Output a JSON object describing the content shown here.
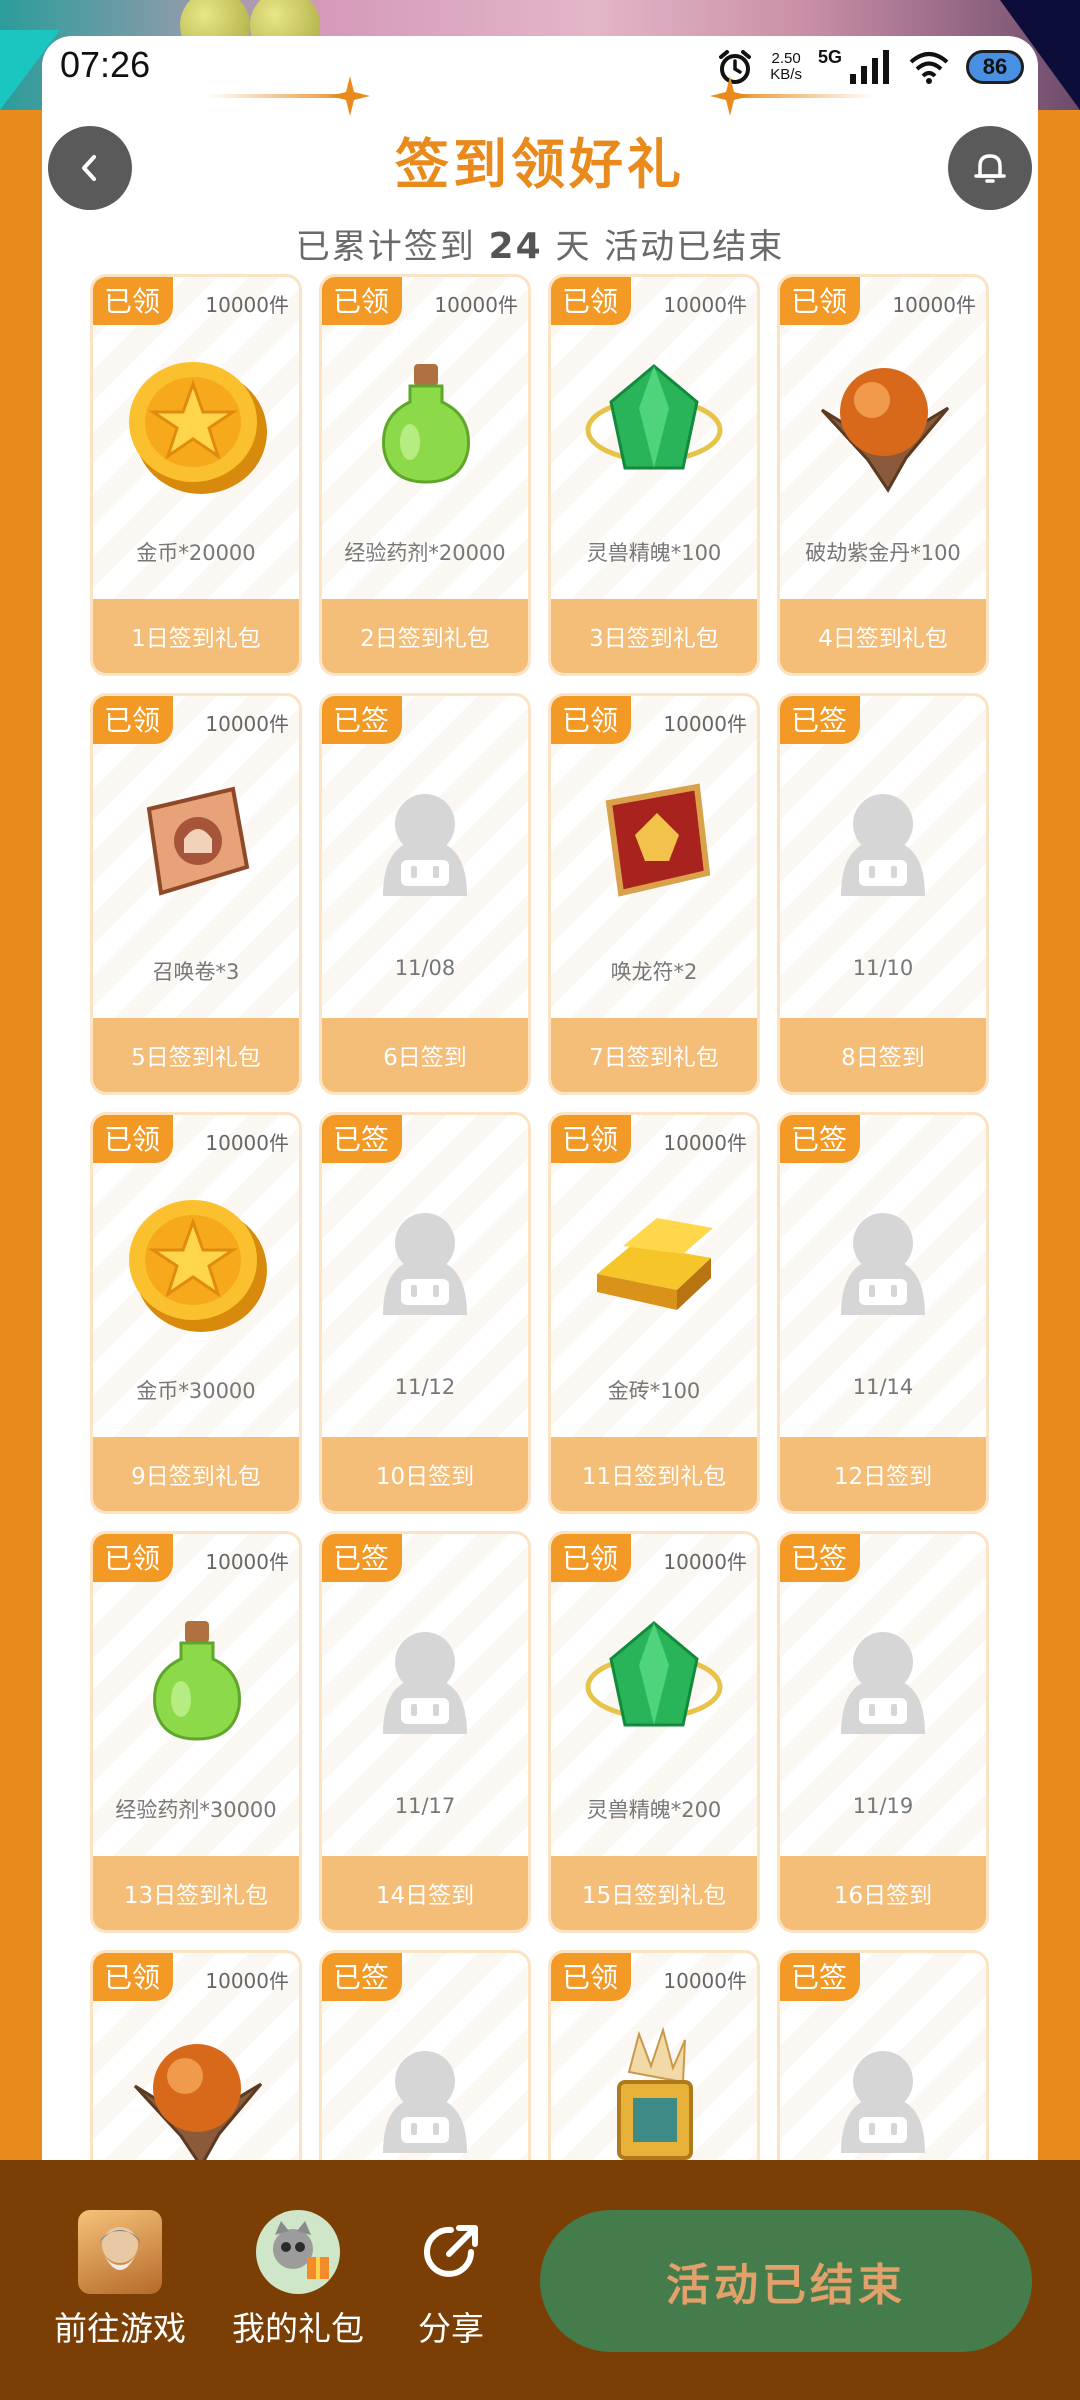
{
  "status_bar": {
    "time": "07:26",
    "net_speed_value": "2.50",
    "net_speed_unit": "KB/s",
    "network": "5G",
    "battery": "86"
  },
  "header": {
    "title": "签到领好礼",
    "subtitle_prefix": "已累计签到",
    "days": "24",
    "subtitle_suffix": "天  活动已结束"
  },
  "cards": [
    {
      "badge": "已领",
      "qty": "10000件",
      "icon": "gold-coin",
      "name": "金币*20000",
      "footer": "1日签到礼包"
    },
    {
      "badge": "已领",
      "qty": "10000件",
      "icon": "exp-potion",
      "name": "经验药剂*20000",
      "footer": "2日签到礼包"
    },
    {
      "badge": "已领",
      "qty": "10000件",
      "icon": "green-gem",
      "name": "灵兽精魄*100",
      "footer": "3日签到礼包"
    },
    {
      "badge": "已领",
      "qty": "10000件",
      "icon": "orange-orb",
      "name": "破劫紫金丹*100",
      "footer": "4日签到礼包"
    },
    {
      "badge": "已领",
      "qty": "10000件",
      "icon": "summon-scroll",
      "name": "召唤卷*3",
      "footer": "5日签到礼包"
    },
    {
      "badge": "已签",
      "qty": "",
      "icon": "placeholder",
      "name": "11/08",
      "footer": "6日签到"
    },
    {
      "badge": "已领",
      "qty": "10000件",
      "icon": "dragon-talisman",
      "name": "唤龙符*2",
      "footer": "7日签到礼包"
    },
    {
      "badge": "已签",
      "qty": "",
      "icon": "placeholder",
      "name": "11/10",
      "footer": "8日签到"
    },
    {
      "badge": "已领",
      "qty": "10000件",
      "icon": "gold-coin",
      "name": "金币*30000",
      "footer": "9日签到礼包"
    },
    {
      "badge": "已签",
      "qty": "",
      "icon": "placeholder",
      "name": "11/12",
      "footer": "10日签到"
    },
    {
      "badge": "已领",
      "qty": "10000件",
      "icon": "gold-bar",
      "name": "金砖*100",
      "footer": "11日签到礼包"
    },
    {
      "badge": "已签",
      "qty": "",
      "icon": "placeholder",
      "name": "11/14",
      "footer": "12日签到"
    },
    {
      "badge": "已领",
      "qty": "10000件",
      "icon": "exp-potion",
      "name": "经验药剂*30000",
      "footer": "13日签到礼包"
    },
    {
      "badge": "已签",
      "qty": "",
      "icon": "placeholder",
      "name": "11/17",
      "footer": "14日签到"
    },
    {
      "badge": "已领",
      "qty": "10000件",
      "icon": "green-gem",
      "name": "灵兽精魄*200",
      "footer": "15日签到礼包"
    },
    {
      "badge": "已签",
      "qty": "",
      "icon": "placeholder",
      "name": "11/19",
      "footer": "16日签到"
    },
    {
      "badge": "已领",
      "qty": "10000件",
      "icon": "orange-orb",
      "name": "",
      "footer": ""
    },
    {
      "badge": "已签",
      "qty": "",
      "icon": "placeholder",
      "name": "",
      "footer": ""
    },
    {
      "badge": "已领",
      "qty": "10000件",
      "icon": "crystal-lantern",
      "name": "",
      "footer": ""
    },
    {
      "badge": "已签",
      "qty": "",
      "icon": "placeholder",
      "name": "",
      "footer": ""
    }
  ],
  "bottom_nav": {
    "go_game": "前往游戏",
    "my_gifts": "我的礼包",
    "share": "分享",
    "ended_button": "活动已结束"
  },
  "colors": {
    "accent": "#E98A1C",
    "badge": "#F29A25",
    "footer": "#F5BE78",
    "bottom_bar": "#7B3F06",
    "ended_button": "#457C4B"
  }
}
